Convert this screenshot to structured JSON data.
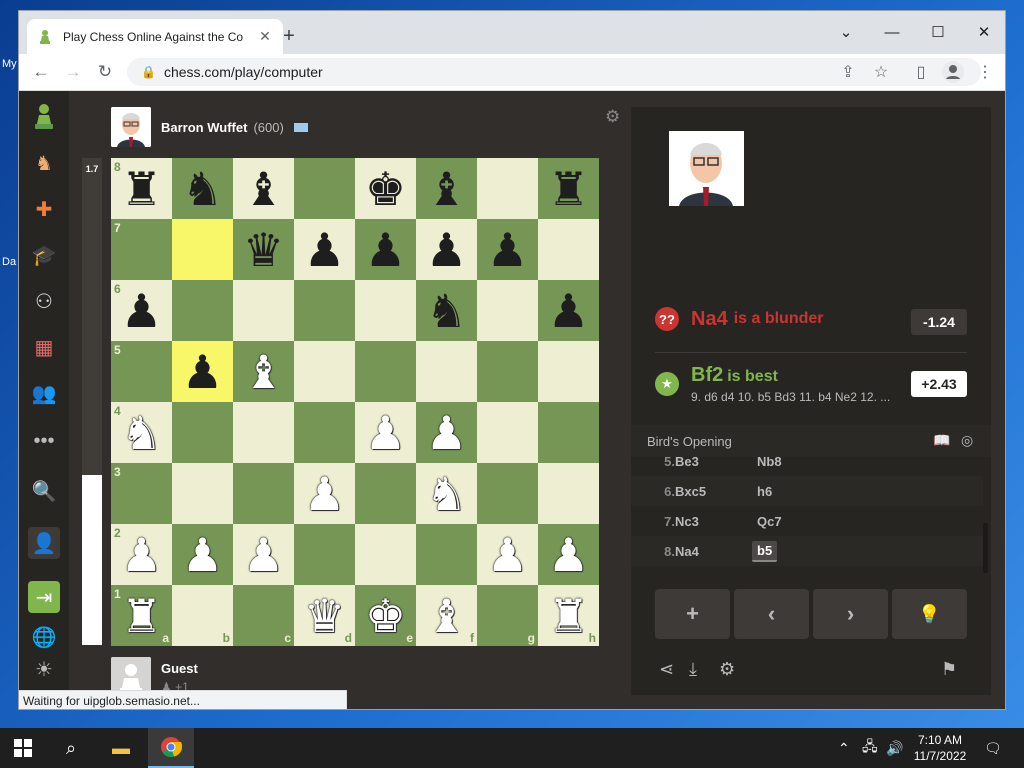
{
  "desktop": {
    "label_top": "My",
    "label_bottom": "Da"
  },
  "browser": {
    "tab_title": "Play Chess Online Against the Co",
    "tab_close": "✕",
    "new_tab": "+",
    "url": "chess.com/play/computer",
    "status_text": "Waiting for uipglob.semasio.net..."
  },
  "top_player": {
    "name": "Barron Wuffet",
    "rating": "(600)"
  },
  "bottom_player": {
    "name": "Guest",
    "captured": "+1"
  },
  "eval_bar": {
    "value": "1.7",
    "white_fraction": 0.35
  },
  "board": {
    "ranks": [
      "8",
      "7",
      "6",
      "5",
      "4",
      "3",
      "2",
      "1"
    ],
    "files": [
      "a",
      "b",
      "c",
      "d",
      "e",
      "f",
      "g",
      "h"
    ],
    "rows": [
      [
        "br",
        "bn",
        "bb",
        "",
        "bk",
        "bb",
        "",
        "br"
      ],
      [
        "",
        "",
        "bq",
        "bp",
        "bp",
        "bp",
        "bp",
        ""
      ],
      [
        "bp",
        "",
        "",
        "",
        "",
        "bn",
        "",
        "bp"
      ],
      [
        "",
        "bp",
        "wb",
        "",
        "",
        "",
        "",
        ""
      ],
      [
        "wn",
        "",
        "",
        "",
        "wp",
        "wp",
        "",
        ""
      ],
      [
        "",
        "",
        "",
        "wp",
        "",
        "wn",
        "",
        ""
      ],
      [
        "wp",
        "wp",
        "wp",
        "",
        "",
        "",
        "wp",
        "wp"
      ],
      [
        "wr",
        "",
        "",
        "wq",
        "wk",
        "wb",
        "",
        "wr"
      ]
    ],
    "highlight": [
      "b7",
      "b5"
    ]
  },
  "analysis": {
    "blunder_icon": "??",
    "blunder_move": "Na4",
    "blunder_text": "is a blunder",
    "blunder_eval": "-1.24",
    "best_move": "Bf2",
    "best_text": "is best",
    "best_eval": "+2.43",
    "best_line": "9. d6 d4 10. b5 Bd3 11. b4 Ne2 12. ..."
  },
  "opening": "Bird's Opening",
  "moves": [
    {
      "no": "5.",
      "white": "Be3",
      "black": "Nb8"
    },
    {
      "no": "6.",
      "white": "Bxc5",
      "black": "h6"
    },
    {
      "no": "7.",
      "white": "Nc3",
      "black": "Qc7"
    },
    {
      "no": "8.",
      "white": "Na4",
      "black": "b5"
    }
  ],
  "controls": {
    "add": "+",
    "back": "‹",
    "forward": "›",
    "hint": "💡"
  },
  "taskbar": {
    "time": "7:10 AM",
    "date": "11/7/2022"
  },
  "colors": {
    "board_light": "#eeeed2",
    "board_dark": "#769656",
    "highlight": "#f7f769",
    "blunder": "#ca3431",
    "best": "#81b64c"
  }
}
